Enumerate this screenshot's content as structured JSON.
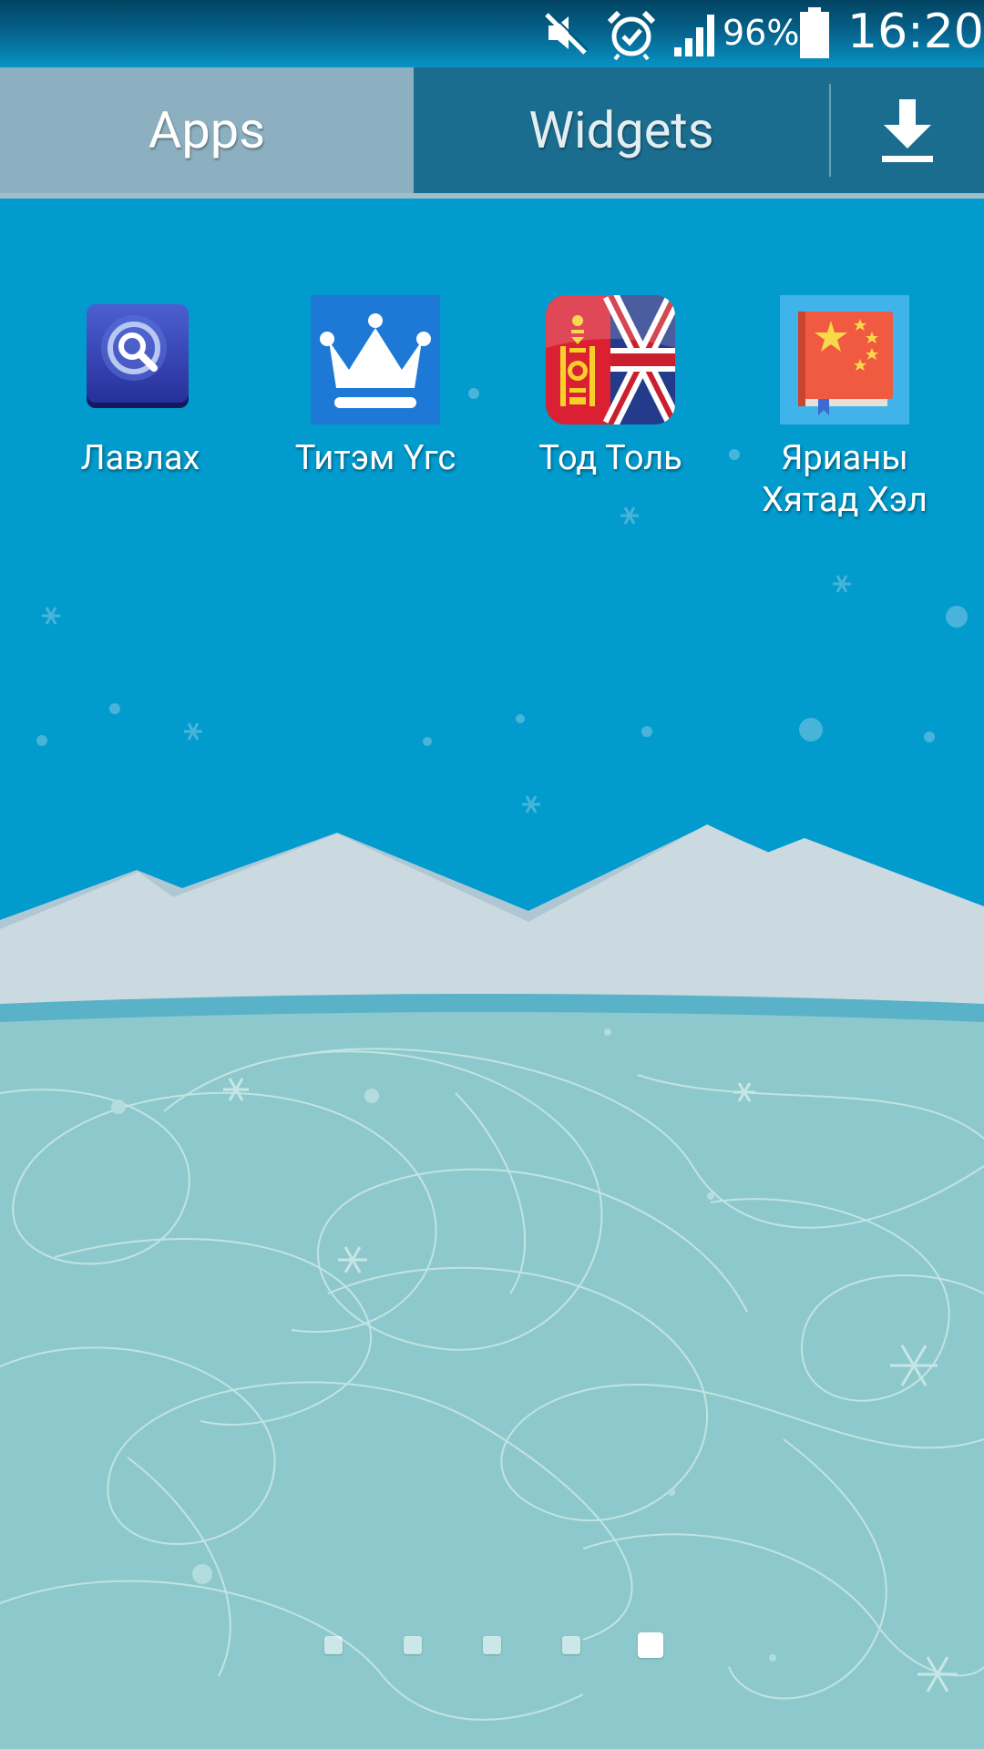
{
  "status_bar": {
    "battery_percent": "96%",
    "time": "16:20",
    "icons": [
      "mute-icon",
      "alarm-icon",
      "signal-icon",
      "battery-icon"
    ]
  },
  "tabs": {
    "apps_label": "Apps",
    "widgets_label": "Widgets",
    "active": "Apps",
    "download_icon": "download-icon"
  },
  "apps": [
    {
      "label": "Лавлах",
      "icon": "magnifier-icon",
      "color": "#3541a8"
    },
    {
      "label": "Титэм Үгс",
      "icon": "crown-icon",
      "color": "#1e78d6"
    },
    {
      "label": "Тод Толь",
      "icon": "flag-icon",
      "color": "#da2032"
    },
    {
      "label": "Ярианы\nХятад Хэл",
      "label_line1": "Ярианы",
      "label_line2": "Хятад Хэл",
      "icon": "book-icon",
      "color": "#3fb3ea"
    }
  ],
  "page_indicator": {
    "pages": 5,
    "active_page": 5
  },
  "colors": {
    "sky": "#019bce",
    "mountains": "#cbd9e0",
    "ground": "#8dc9cc",
    "tab_bar": "#1a6d8e",
    "active_tab": "#8cb0c0"
  }
}
